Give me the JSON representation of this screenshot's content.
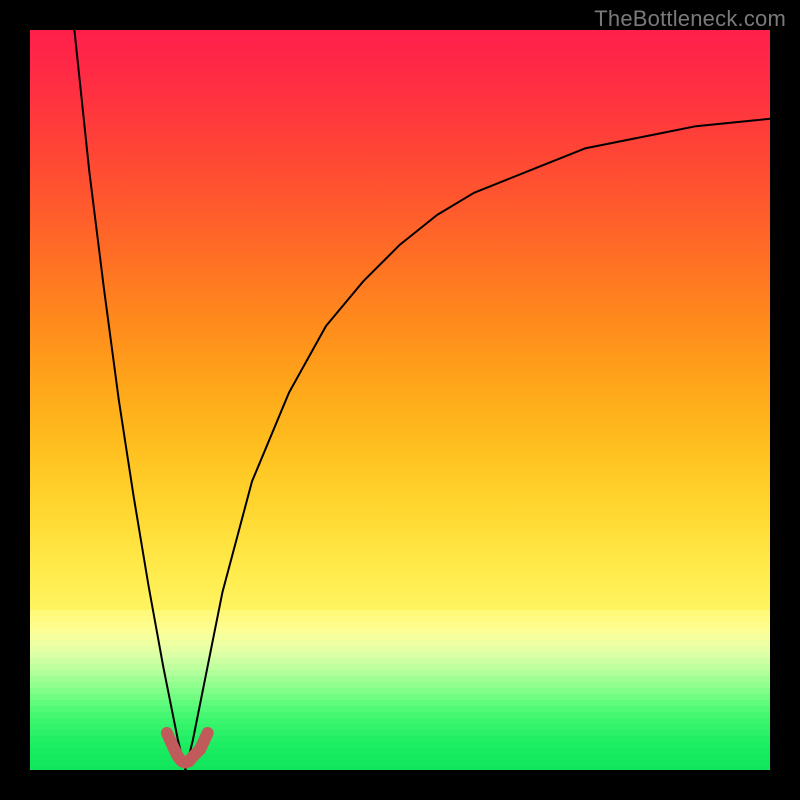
{
  "watermark": "TheBottleneck.com",
  "chart_data": {
    "type": "line",
    "title": "",
    "xlabel": "",
    "ylabel": "",
    "xlim": [
      0,
      100
    ],
    "ylim": [
      0,
      100
    ],
    "legend": false,
    "grid": false,
    "background": "vertical gradient red (top) → orange → yellow → green (bottom)",
    "annotations": [
      {
        "text": "TheBottleneck.com",
        "position": "top-right",
        "role": "watermark"
      }
    ],
    "series": [
      {
        "name": "curve",
        "stroke": "#000000",
        "stroke_width": 2,
        "x": [
          6,
          8,
          10,
          12,
          14,
          16,
          18,
          20,
          21,
          22,
          24,
          26,
          30,
          35,
          40,
          45,
          50,
          55,
          60,
          65,
          70,
          75,
          80,
          85,
          90,
          95,
          100
        ],
        "values": [
          100,
          81,
          65,
          50,
          37,
          25,
          14,
          4,
          0,
          4,
          14,
          24,
          39,
          51,
          60,
          66,
          71,
          75,
          78,
          80,
          82,
          84,
          85,
          86,
          87,
          87.5,
          88
        ]
      },
      {
        "name": "trough-marker",
        "stroke": "#c15a5a",
        "stroke_width": 12,
        "linecap": "round",
        "x": [
          18.5,
          19.5,
          20,
          20.5,
          21,
          21.5,
          22,
          23,
          24
        ],
        "values": [
          5,
          2.8,
          1.8,
          1.2,
          1,
          1.2,
          1.8,
          2.8,
          5
        ]
      }
    ]
  }
}
